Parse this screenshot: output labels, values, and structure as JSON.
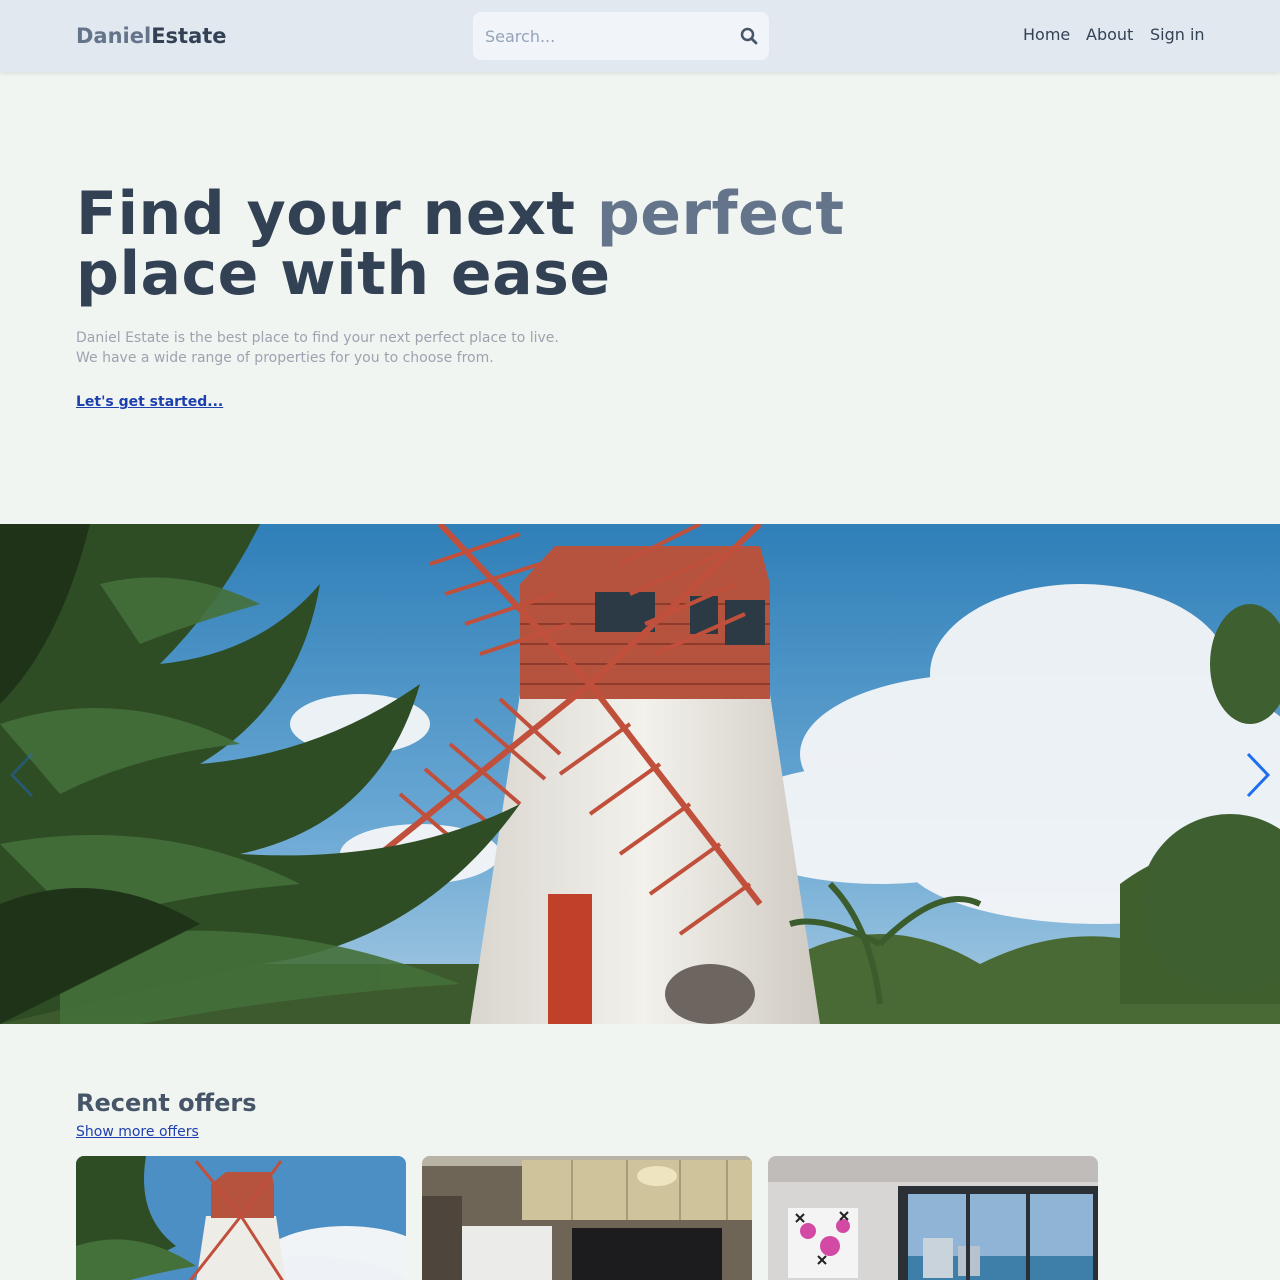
{
  "header": {
    "logo_part1": "Daniel",
    "logo_part2": "Estate",
    "search_placeholder": "Search...",
    "search_icon": "search-icon",
    "nav": [
      "Home",
      "About",
      "Sign in"
    ]
  },
  "hero": {
    "title_part1": "Find your next ",
    "title_accent": "perfect",
    "title_part2": "place with ease",
    "description_line1": "Daniel Estate is the best place to find your next perfect place to live.",
    "description_line2": "We have a wide range of properties for you to choose from.",
    "cta": "Let's get started..."
  },
  "slider": {
    "image": "windmill-photo",
    "prev_icon": "chevron-left-icon",
    "next_icon": "chevron-right-icon"
  },
  "offers": {
    "title": "Recent offers",
    "show_more": "Show more offers",
    "cards": [
      {
        "image": "windmill-photo"
      },
      {
        "image": "kitchen-photo"
      },
      {
        "image": "bedroom-ocean-view-photo"
      }
    ]
  },
  "colors": {
    "header_bg": "#e2e8f0",
    "page_bg": "#f1f5f1",
    "accent_link": "#1e40af",
    "slider_arrow": "#1d6ef0"
  }
}
